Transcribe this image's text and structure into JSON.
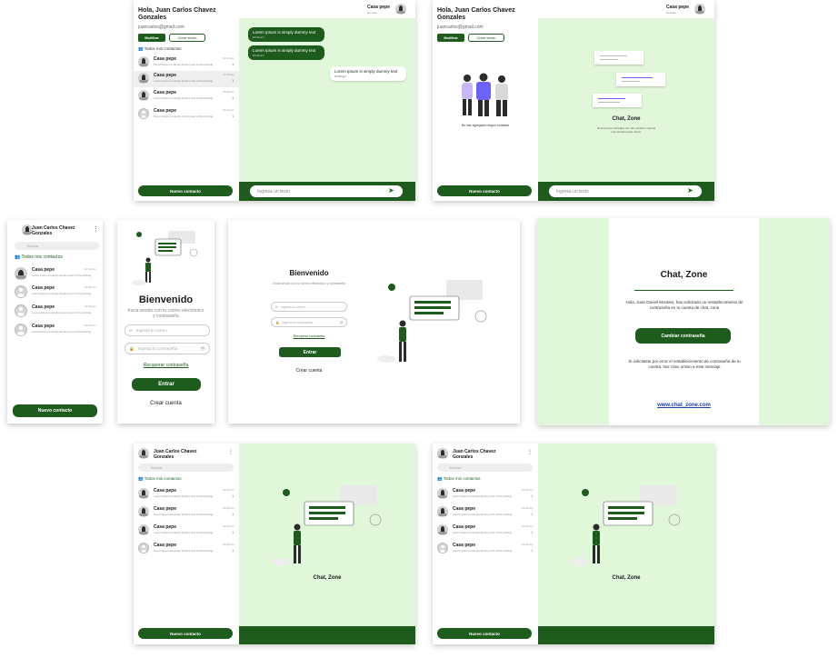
{
  "user": {
    "greeting": "Hola, Juan Carlos Chavez Gonzales",
    "email": "juancarlos@gmail.com",
    "name": "Juan Carlos Chavez Gonzales",
    "modify_label": "Modificar",
    "logout_label": "Cerrar sesión"
  },
  "contacts_header": "Todos mis contactos",
  "contacts": [
    {
      "name": "Casa pepe",
      "message": "Lorem Ipsum is simply dummy text of the printing",
      "time": "10:30 am",
      "count": "1"
    },
    {
      "name": "Casa pepe",
      "message": "Lorem Ipsum is simply dummy text of the printing",
      "time": "10:30 am",
      "count": "1"
    },
    {
      "name": "Casa pepe",
      "message": "Lorem Ipsum is simply dummy text of the printing",
      "time": "10:30 am",
      "count": "1"
    },
    {
      "name": "Casa pepe",
      "message": "Lorem Ipsum is simply dummy text of the printing",
      "time": "10:30 am",
      "count": "1"
    }
  ],
  "chat_header": {
    "name": "Casa pepe",
    "status": "En linea"
  },
  "messages": [
    {
      "text": "Lorem Ipsum is simply dummy text",
      "time": "10:30 am",
      "type": "sent"
    },
    {
      "text": "Lorem Ipsum is simply dummy text",
      "time": "10:30 am",
      "type": "sent"
    },
    {
      "text": "Lorem Ipsum is simply dummy text",
      "time": "10:30 am",
      "type": "received"
    }
  ],
  "message_placeholder": "Ingresa un texto",
  "new_contact_label": "Nuevo contacto",
  "no_contacts_text": "No has agregado ningun contacto",
  "chat_zone": {
    "title": "Chat, Zone",
    "desc": "Nunca envio mensajes con otro usuario, ingresa una contacto para iniciar."
  },
  "search_placeholder": "Buscar",
  "login": {
    "title": "Bienvenido",
    "subtitle": "Inicia sesión con tu correo electrónico y contraseña",
    "email_placeholder": "Ingresa tu correo",
    "password_placeholder": "Ingresa tu contraseña",
    "recover_label": "Recuperar contraseña",
    "submit_label": "Entrar",
    "create_label": "Crear cuenta"
  },
  "email_template": {
    "title": "Chat, Zone",
    "greeting": "Hola, Juan Daniel Morales, has solicitado un restablecimiento de contraseña en tu cuenta de chat, zone",
    "button": "Cambiar contraseña",
    "note": "Si solicitaste por error el restablecimiento de contraseña de tu cuenta, haz caso omiso a este mensaje",
    "link": "www.chat_zone.com"
  },
  "colors": {
    "brand": "#1e5c1e",
    "light_green": "#e1f7d9"
  }
}
